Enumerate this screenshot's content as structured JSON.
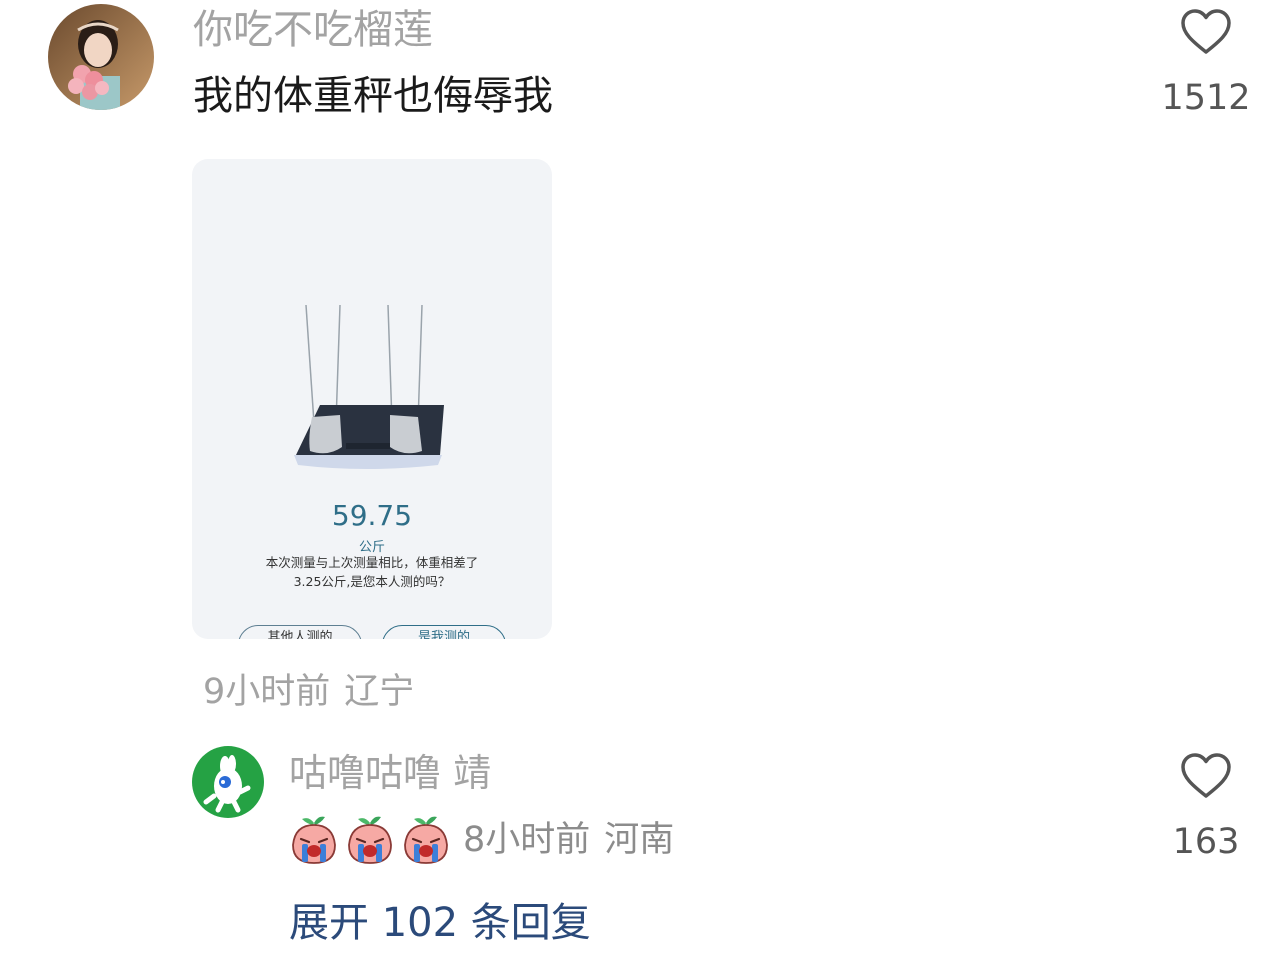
{
  "comment": {
    "username": "你吃不吃榴莲",
    "text": "我的体重秤也侮辱我",
    "likes": "1512",
    "time": "9小时前",
    "location": "辽宁",
    "avatar_icon": "avatar-photo-girl-with-flowers",
    "like_icon": "heart-outline-icon"
  },
  "image": {
    "weight": "59.75",
    "unit": "公斤",
    "message": "本次测量与上次测量相比，体重相差了3.25公斤,是您本人测的吗？",
    "button_other": "其他人测的",
    "button_mine": "是我测的"
  },
  "reply": {
    "username": "咕噜咕噜 靖",
    "emoji_count": 3,
    "emoji_icon": "crying-peach-emoji",
    "time": "8小时前",
    "location": "河南",
    "likes": "163",
    "avatar_icon": "avatar-green-cartoon",
    "like_icon": "heart-outline-icon"
  },
  "expand": {
    "label": "展开 102 条回复"
  },
  "colors": {
    "username": "#a3a3a3",
    "text": "#1a1a1a",
    "link": "#2b4a7a",
    "weight": "#2f6e88"
  }
}
